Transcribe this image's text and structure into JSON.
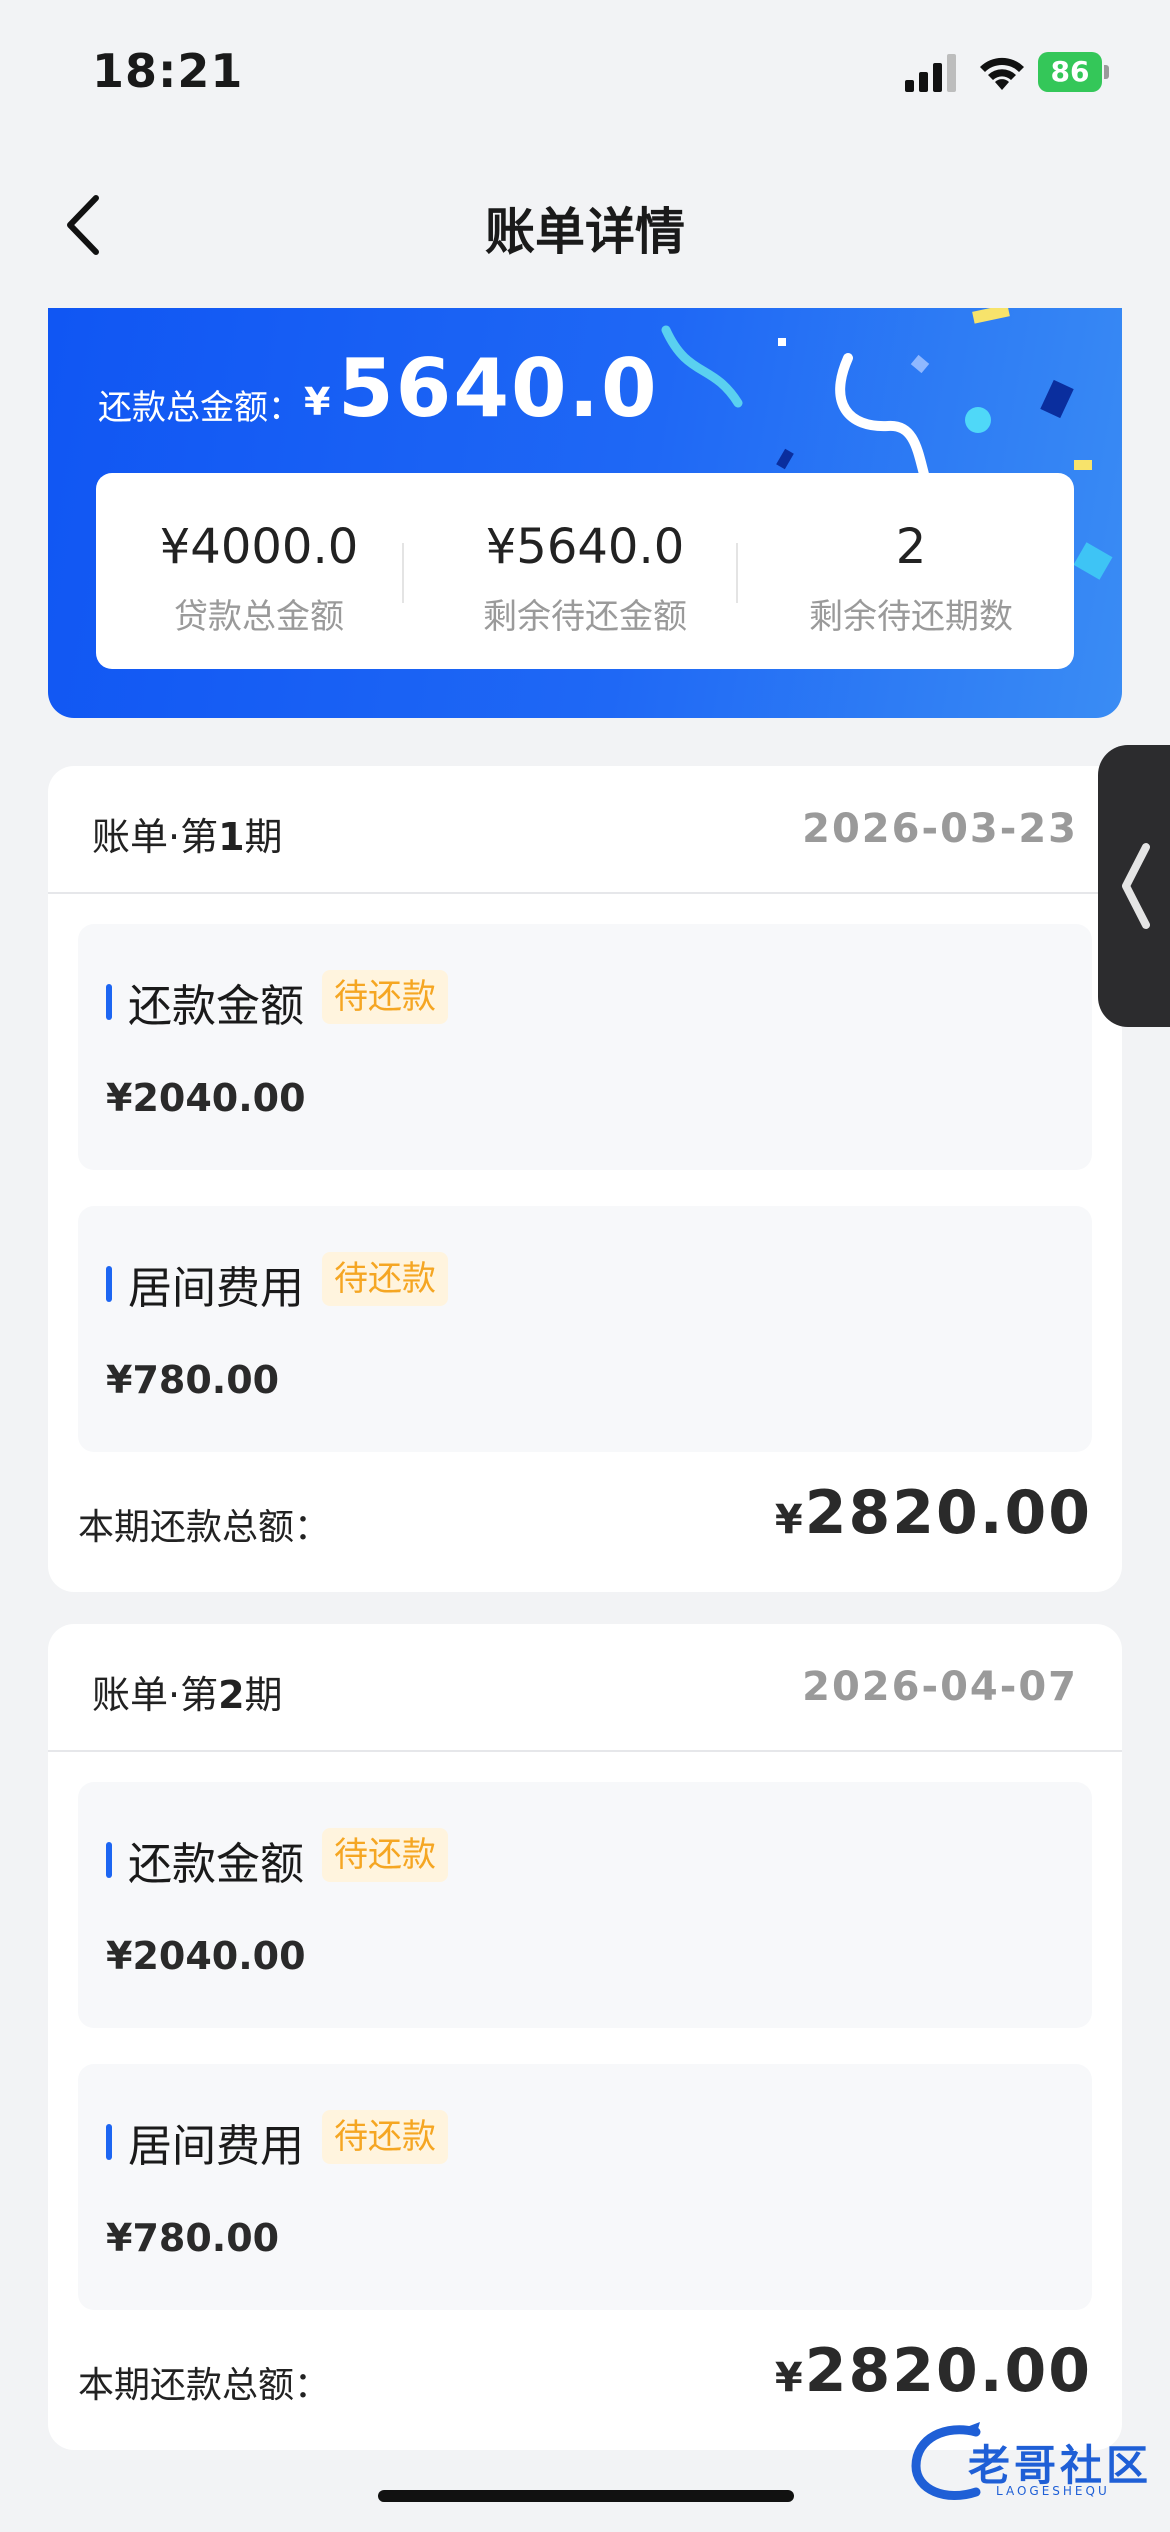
{
  "status_bar": {
    "time": "18:21",
    "battery": "86"
  },
  "header": {
    "title": "账单详情"
  },
  "summary": {
    "total_label": "还款总金额：",
    "currency": "¥",
    "total_amount": "5640.0",
    "stats": [
      {
        "value": "¥4000.0",
        "label": "贷款总金额"
      },
      {
        "value": "¥5640.0",
        "label": "剩余待还金额"
      },
      {
        "value": "2",
        "label": "剩余待还期数"
      }
    ]
  },
  "bills": [
    {
      "period_prefix": "账单·第",
      "period_num": "1",
      "period_suffix": "期",
      "date": "2026-03-23",
      "items": [
        {
          "name": "还款金额",
          "status": "待还款",
          "amount": "¥2040.00"
        },
        {
          "name": "居间费用",
          "status": "待还款",
          "amount": "¥780.00"
        }
      ],
      "total_label": "本期还款总额：",
      "total_currency": "¥",
      "total_amount": "2820.00"
    },
    {
      "period_prefix": "账单·第",
      "period_num": "2",
      "period_suffix": "期",
      "date": "2026-04-07",
      "items": [
        {
          "name": "还款金额",
          "status": "待还款",
          "amount": "¥2040.00"
        },
        {
          "name": "居间费用",
          "status": "待还款",
          "amount": "¥780.00"
        }
      ],
      "total_label": "本期还款总额：",
      "total_currency": "¥",
      "total_amount": "2820.00"
    }
  ],
  "watermark": {
    "text": "老哥社区",
    "sub": "LAOGESHEQU"
  },
  "colors": {
    "primary": "#1d66f2",
    "tag_text": "#f5a623",
    "tag_bg": "#fff4de",
    "background": "#f2f3f5"
  }
}
